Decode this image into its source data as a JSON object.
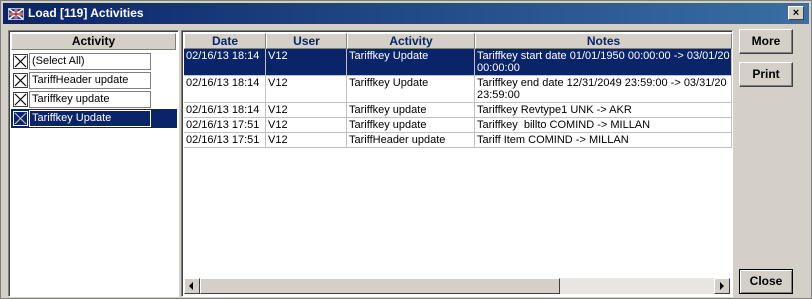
{
  "window": {
    "title": "Load [119] Activities",
    "close_glyph": "×"
  },
  "activity_panel": {
    "header": "Activity",
    "items": [
      {
        "label": "(Select All)",
        "checked": true,
        "selected": false
      },
      {
        "label": "TariffHeader update",
        "checked": true,
        "selected": false
      },
      {
        "label": "Tariffkey update",
        "checked": true,
        "selected": false
      },
      {
        "label": "Tariffkey Update",
        "checked": true,
        "selected": true
      }
    ]
  },
  "grid": {
    "columns": [
      "Date",
      "User",
      "Activity",
      "Notes"
    ],
    "rows": [
      {
        "date": "02/16/13 18:14",
        "user": "V12",
        "activity": "Tariffkey Update",
        "notes": "Tariffkey start date 01/01/1950 00:00:00 -> 03/01/20\n00:00:00",
        "selected": true
      },
      {
        "date": "02/16/13 18:14",
        "user": "V12",
        "activity": "Tariffkey Update",
        "notes": "Tariffkey end date 12/31/2049 23:59:00 -> 03/31/20\n23:59:00",
        "selected": false
      },
      {
        "date": "02/16/13 18:14",
        "user": "V12",
        "activity": "Tariffkey update",
        "notes": "Tariffkey Revtype1 UNK -> AKR",
        "selected": false
      },
      {
        "date": "02/16/13 17:51",
        "user": "V12",
        "activity": "Tariffkey update",
        "notes": "Tariffkey  billto COMIND -> MILLAN",
        "selected": false
      },
      {
        "date": "02/16/13 17:51",
        "user": "V12",
        "activity": "TariffHeader update",
        "notes": "Tariff Item COMIND -> MILLAN",
        "selected": false
      }
    ]
  },
  "buttons": {
    "more": "More",
    "print": "Print",
    "close": "Close"
  },
  "colors": {
    "title_bar": "#0a246a",
    "selection": "#0a246a",
    "face": "#d4d0c8"
  }
}
